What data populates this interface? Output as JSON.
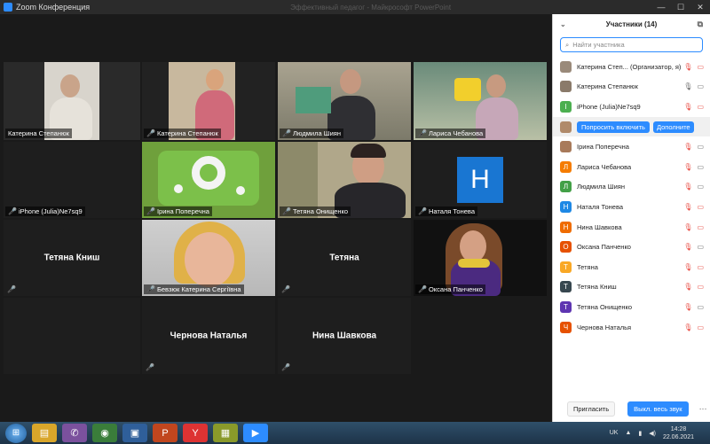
{
  "window": {
    "title": "Zoom Конференция",
    "ghost_title": "Эффективный педагог - Майкрософт PowerPoint"
  },
  "gallery": {
    "tiles": [
      {
        "name": "Катерина Степанюк",
        "active": true
      },
      {
        "name": "Катерина Степанюк"
      },
      {
        "name": "Людмила Шиян"
      },
      {
        "name": "Лариса Чебанова"
      },
      {
        "name": "iPhone (Julia)Ne7sq9"
      },
      {
        "name": "Ірина Поперечна"
      },
      {
        "name": "Тетяна Онищенко"
      },
      {
        "name": "Наталя Тонева",
        "letter": "Н"
      },
      {
        "name": "Тетяна Книш",
        "big": "Тетяна Книш"
      },
      {
        "name": "Бевзюк Катерина Сергіївна"
      },
      {
        "name": "Тетяна",
        "big": "Тетяна"
      },
      {
        "name": "Оксана Панченко"
      },
      {
        "name": "",
        "big": ""
      },
      {
        "name": "Чернова Наталья",
        "big": "Чернова Наталья"
      },
      {
        "name": "Нина Шавкова",
        "big": "Нина Шавкова"
      }
    ]
  },
  "panel": {
    "title": "Участники (14)",
    "search_placeholder": "Найти участника",
    "participants": [
      {
        "name": "Катерина Степ... (Организатор, я)",
        "avatar": "photo",
        "color": "#9a8a7a"
      },
      {
        "name": "Катерина Степанюк",
        "avatar": "photo",
        "color": "#8a7a6a"
      },
      {
        "name": "iPhone (Julia)Ne7sq9",
        "avatar": "I",
        "color": "#4caf50"
      },
      {
        "name": "",
        "avatar": "photo",
        "color": "#b08a6a",
        "ask_label": "Попросить включить",
        "more_label": "Дополните"
      },
      {
        "name": "Ірина Поперечна",
        "avatar": "photo",
        "color": "#a87a5a"
      },
      {
        "name": "Лариса Чебанова",
        "avatar": "Л",
        "color": "#f57c00"
      },
      {
        "name": "Людмила Шиян",
        "avatar": "Л",
        "color": "#43a047"
      },
      {
        "name": "Наталя Тонева",
        "avatar": "Н",
        "color": "#1e88e5"
      },
      {
        "name": "Нина Шавкова",
        "avatar": "Н",
        "color": "#ef6c00"
      },
      {
        "name": "Оксана Панченко",
        "avatar": "О",
        "color": "#e65100"
      },
      {
        "name": "Тетяна",
        "avatar": "Т",
        "color": "#f9a825"
      },
      {
        "name": "Тетяна Книш",
        "avatar": "Т",
        "color": "#37474f"
      },
      {
        "name": "Тетяна Онищенко",
        "avatar": "Т",
        "color": "#5e35b1"
      },
      {
        "name": "Чернова Наталья",
        "avatar": "Ч",
        "color": "#e65100"
      }
    ],
    "invite_label": "Пригласить",
    "mute_all_label": "Выкл. весь звук",
    "more_label": "···"
  },
  "taskbar": {
    "lang": "UK",
    "time": "14:28",
    "date": "22.06.2021"
  }
}
